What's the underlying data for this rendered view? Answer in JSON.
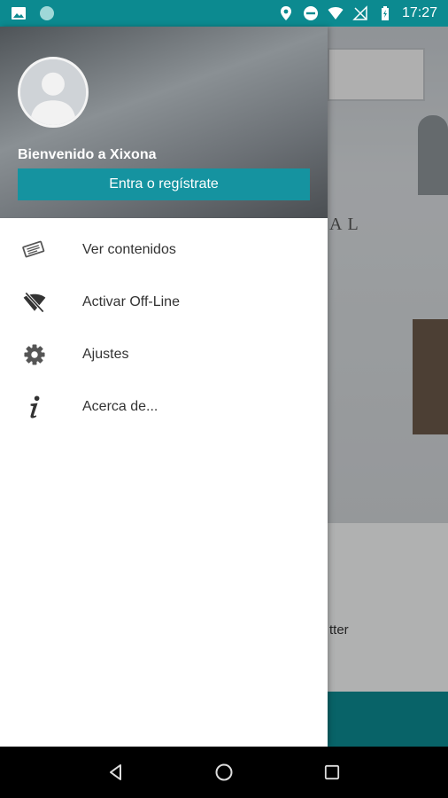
{
  "status_bar": {
    "time": "17:27",
    "icons": [
      "image-icon",
      "circle-app-icon",
      "location-icon",
      "dnd-icon",
      "wifi-icon",
      "no-signal-icon",
      "battery-icon"
    ]
  },
  "drawer": {
    "welcome_text": "Bienvenido a Xixona",
    "login_button": "Entra o regístrate",
    "menu": [
      {
        "label": "Ver contenidos",
        "icon": "contents-icon"
      },
      {
        "label": "Activar Off-Line",
        "icon": "wifi-off-icon"
      },
      {
        "label": "Ajustes",
        "icon": "gear-icon"
      },
      {
        "label": "Acerca de...",
        "icon": "info-icon"
      }
    ]
  },
  "background": {
    "sign_text": "AL",
    "partial_text": "tter"
  },
  "colors": {
    "accent": "#1593a0",
    "status_bar": "#0c8a90"
  }
}
